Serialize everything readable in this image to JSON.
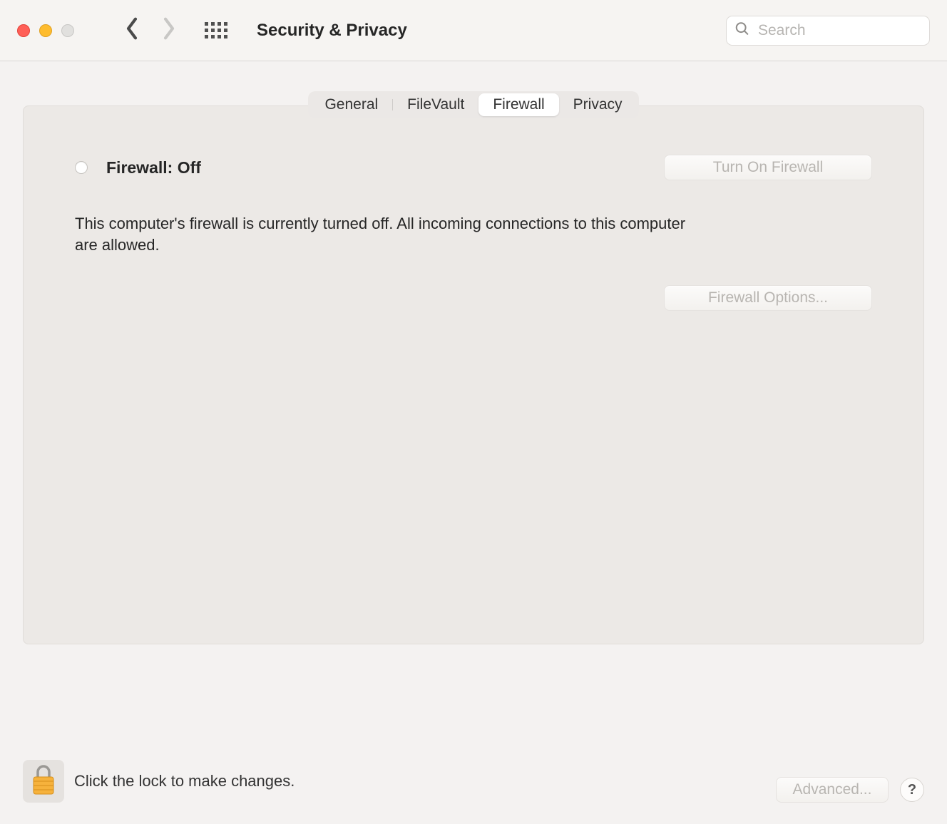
{
  "header": {
    "title": "Security & Privacy",
    "search_placeholder": "Search"
  },
  "tabs": {
    "general": "General",
    "filevault": "FileVault",
    "firewall": "Firewall",
    "privacy": "Privacy",
    "active": "firewall"
  },
  "firewall": {
    "status_label": "Firewall: Off",
    "turn_on_label": "Turn On Firewall",
    "description": "This computer's firewall is currently turned off. All incoming connections to this computer are allowed.",
    "options_label": "Firewall Options..."
  },
  "footer": {
    "lock_text": "Click the lock to make changes.",
    "advanced_label": "Advanced...",
    "help_label": "?"
  }
}
